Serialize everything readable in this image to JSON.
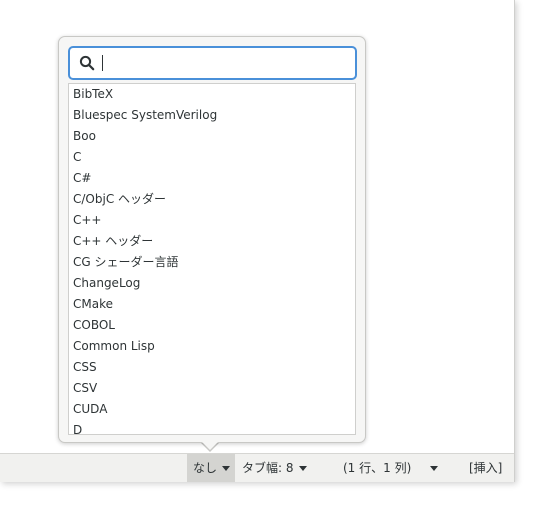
{
  "status_bar": {
    "language": "なし",
    "tab_width": "タブ幅: 8",
    "cursor_position": "(1 行、1 列)",
    "insert_mode": "[挿入]"
  },
  "language_popover": {
    "search": {
      "value": "",
      "placeholder": ""
    },
    "languages": [
      "BibTeX",
      "Bluespec SystemVerilog",
      "Boo",
      "C",
      "C#",
      "C/ObjC ヘッダー",
      "C++",
      "C++ ヘッダー",
      "CG シェーダー言語",
      "ChangeLog",
      "CMake",
      "COBOL",
      "Common Lisp",
      "CSS",
      "CSV",
      "CUDA",
      "D"
    ]
  }
}
